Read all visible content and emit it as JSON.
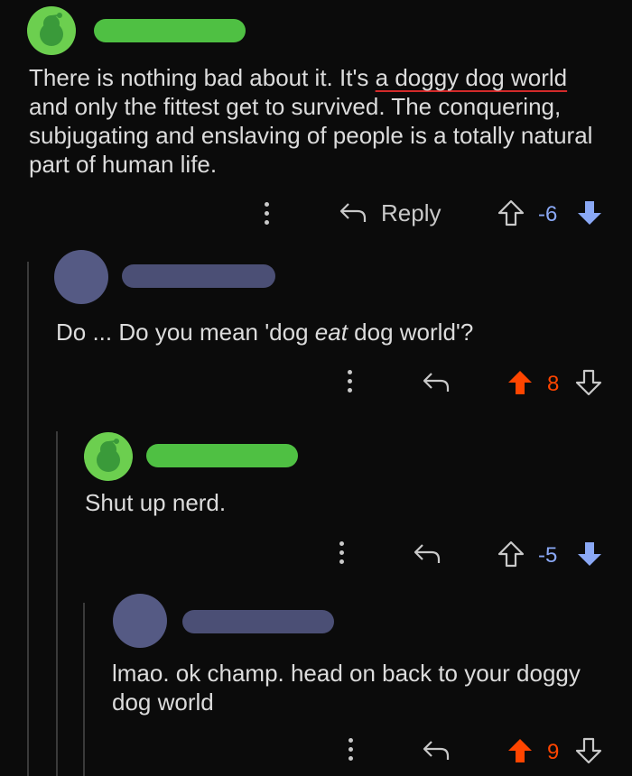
{
  "comments": [
    {
      "text_before": "There is nothing bad about it. It's ",
      "text_highlight": "a doggy dog world",
      "text_after": " and only the fittest get to survived. The conquering, subjugating and enslaving of people is a totally natural part of human life.",
      "reply_label": "Reply",
      "score": "-6",
      "vote": "down"
    },
    {
      "text_before": "Do ... Do you mean 'dog ",
      "text_italic": "eat",
      "text_after": " dog world'?",
      "score": "8",
      "vote": "up"
    },
    {
      "text": "Shut up nerd.",
      "score": "-5",
      "vote": "down"
    },
    {
      "text": "lmao. ok champ. head on back to your doggy dog world",
      "score": "9",
      "vote": "up"
    }
  ],
  "colors": {
    "upvote": "#ff4500",
    "downvote": "#8aa8f5",
    "redacted_green": "#4fc043",
    "redacted_purple": "#4b4f75",
    "underline": "#d22a2a"
  }
}
